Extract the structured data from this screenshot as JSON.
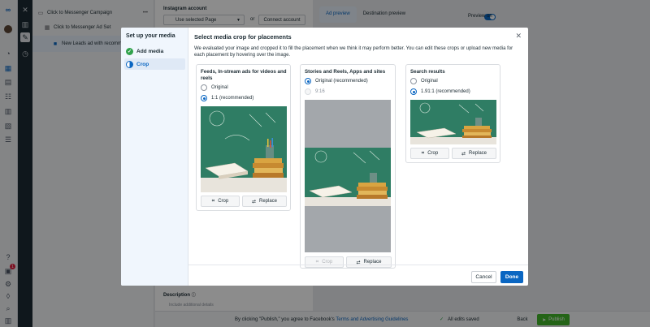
{
  "tree": {
    "campaign": "Click to Messenger Campaign",
    "adset": "Click to Messenger Ad Set",
    "ad": "New Leads ad with recomm..."
  },
  "editor": {
    "instagram_label": "Instagram account",
    "use_page": "Use selected Page",
    "or": "or",
    "connect": "Connect account",
    "description_label": "Description",
    "description_placeholder": "Include additional details"
  },
  "preview": {
    "tab_ad": "Ad preview",
    "tab_destination": "Destination preview",
    "preview_on": "Preview on"
  },
  "bottom": {
    "agree_prefix": "By clicking \"Publish,\" you agree to Facebook's",
    "terms_link": "Terms and Advertising Guidelines",
    "saved": "All edits saved",
    "back": "Back",
    "publish": "Publish"
  },
  "modal": {
    "side_title": "Set up your media",
    "steps": [
      {
        "label": "Add media",
        "state": "done"
      },
      {
        "label": "Crop",
        "state": "active"
      }
    ],
    "title": "Select media crop for placements",
    "description": "We evaluated your image and cropped it to fill the placement when we think it may perform better. You can edit these crops or upload new media for each placement by hovering over the image.",
    "cards": [
      {
        "title": "Feeds, In-stream ads for videos and reels",
        "options": [
          {
            "label": "Original",
            "selected": false,
            "disabled": false
          },
          {
            "label": "1:1 (recommended)",
            "selected": true,
            "disabled": false
          }
        ],
        "crop": "Crop",
        "replace": "Replace"
      },
      {
        "title": "Stories and Reels, Apps and sites",
        "options": [
          {
            "label": "Original (recommended)",
            "selected": true,
            "disabled": false
          },
          {
            "label": "9:16",
            "selected": false,
            "disabled": true
          }
        ],
        "crop": "Crop",
        "replace": "Replace"
      },
      {
        "title": "Search results",
        "options": [
          {
            "label": "Original",
            "selected": false,
            "disabled": false
          },
          {
            "label": "1.91:1 (recommended)",
            "selected": true,
            "disabled": false
          }
        ],
        "crop": "Crop",
        "replace": "Replace"
      }
    ],
    "cancel": "Cancel",
    "done": "Done"
  },
  "colors": {
    "accent": "#0a66c2",
    "success": "#31a24c",
    "publish": "#42b72a",
    "chalkboard": "#2f7d64"
  },
  "notification_count": "1"
}
